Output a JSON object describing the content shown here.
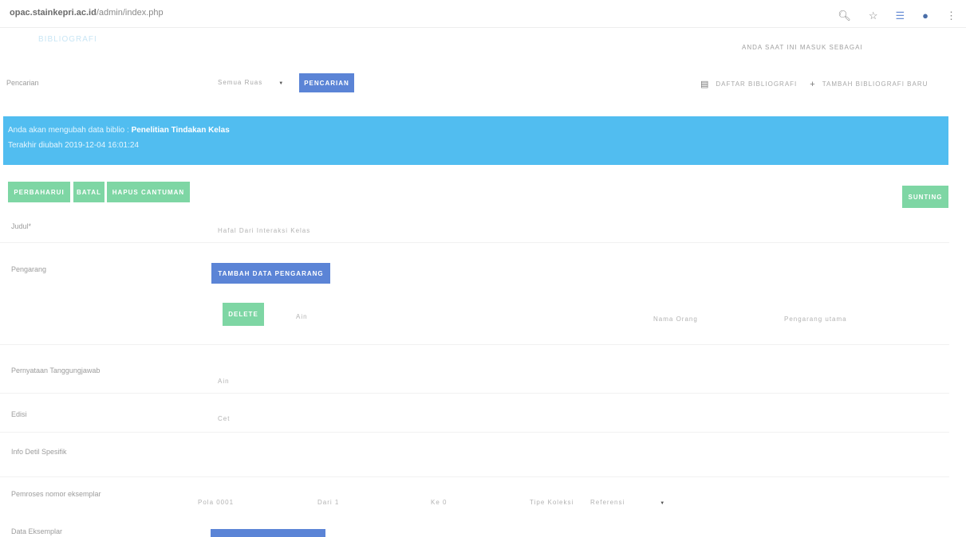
{
  "browser": {
    "url_host": "opac.stainkepri.ac.id",
    "url_path": "/admin/index.php",
    "icons": [
      "zoom-icon",
      "star-icon",
      "extension-icon",
      "profile-icon",
      "menu-dots-icon"
    ]
  },
  "header": {
    "module_title": "BIBLIOGRAFI",
    "login_info": "ANDA SAAT INI MASUK SEBAGAI"
  },
  "search": {
    "label": "Pencarian",
    "ruas_select": "Semua Ruas",
    "button": "PENCARIAN"
  },
  "nav_links": {
    "list": "DAFTAR BIBLIOGRAFI",
    "add": "TAMBAH BIBLIOGRAFI BARU"
  },
  "banner": {
    "prefix": "Anda akan mengubah data biblio :",
    "title": "Penelitian Tindakan Kelas",
    "last_modified": "Terakhir diubah 2019-12-04 16:01:24"
  },
  "actions": {
    "update": "PERBAHARUI",
    "cancel": "BATAL",
    "delete_item": "HAPUS CANTUMAN",
    "edit": "SUNTING"
  },
  "form": {
    "judul_label": "Judul*",
    "judul_value": "Hafal Dari Interaksi Kelas",
    "pengarang_label": "Pengarang",
    "add_author_button": "TAMBAH DATA PENGARANG",
    "author_delete": "DELETE",
    "author_name": "Ain",
    "author_type": "Nama Orang",
    "author_level": "Pengarang utama",
    "responsibility_label": "Pernyataan Tanggungjawab",
    "responsibility_value": "Ain",
    "edition_label": "Edisi",
    "edition_value": "Cet",
    "spec_label": "Info Detil Spesifik",
    "items_label": "Pemroses nomor eksemplar",
    "items_pattern": "Pola 0001",
    "items_from": "Dari 1",
    "items_to": "Ke 0",
    "collection_type_label": "Tipe Koleksi",
    "collection_type_value": "Referensi",
    "eksemplar_label": "Data Eksemplar"
  },
  "colors": {
    "banner": "#51bdf0",
    "primary_button": "#5b84d6",
    "success_button": "#7ed6a4"
  }
}
